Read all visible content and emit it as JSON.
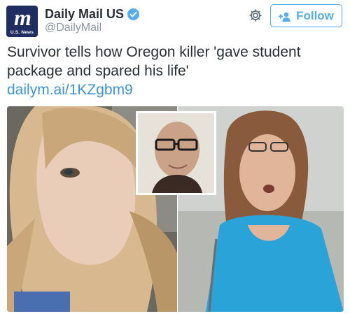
{
  "account": {
    "avatar_text": "m",
    "avatar_subtitle": "U.S. News",
    "display_name": "Daily Mail US",
    "handle": "@DailyMail",
    "verified": true
  },
  "actions": {
    "settings_icon": "gear-icon",
    "follow_label": "Follow",
    "follow_icon": "add-user-icon"
  },
  "tweet": {
    "text": "Survivor tells how Oregon killer 'gave student package and spared his life'",
    "link": "dailym.ai/1KZgbm9"
  },
  "colors": {
    "accent": "#55acee",
    "link": "#3b94d9",
    "avatar_bg": "#1f2d63",
    "muted": "#8899a6"
  }
}
